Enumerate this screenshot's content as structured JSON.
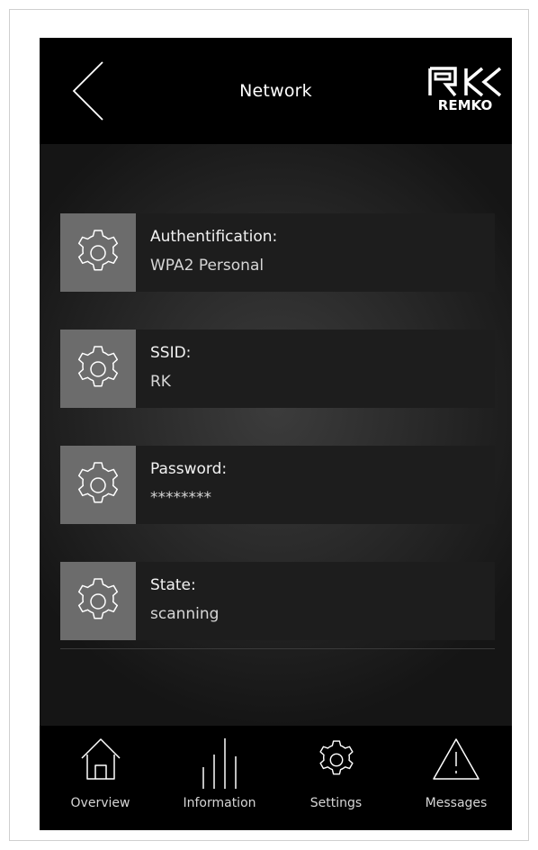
{
  "header": {
    "title": "Network",
    "back_icon": "chevron-left-icon",
    "logo_text": "REMKO"
  },
  "settings": [
    {
      "label": "Authentification:",
      "value": "WPA2 Personal",
      "icon": "gear-icon"
    },
    {
      "label": "SSID:",
      "value": "RK",
      "icon": "gear-icon"
    },
    {
      "label": "Password:",
      "value": "********",
      "icon": "gear-icon"
    },
    {
      "label": "State:",
      "value": "scanning",
      "icon": "gear-icon"
    }
  ],
  "nav": {
    "items": [
      {
        "label": "Overview",
        "icon": "home-icon"
      },
      {
        "label": "Information",
        "icon": "bars-icon"
      },
      {
        "label": "Settings",
        "icon": "gear-icon"
      },
      {
        "label": "Messages",
        "icon": "warning-icon"
      }
    ]
  },
  "colors": {
    "background": "#000000",
    "row_background": "#1d1d1d",
    "icon_tile": "#6c6c6c",
    "text": "#f2f2f2"
  }
}
